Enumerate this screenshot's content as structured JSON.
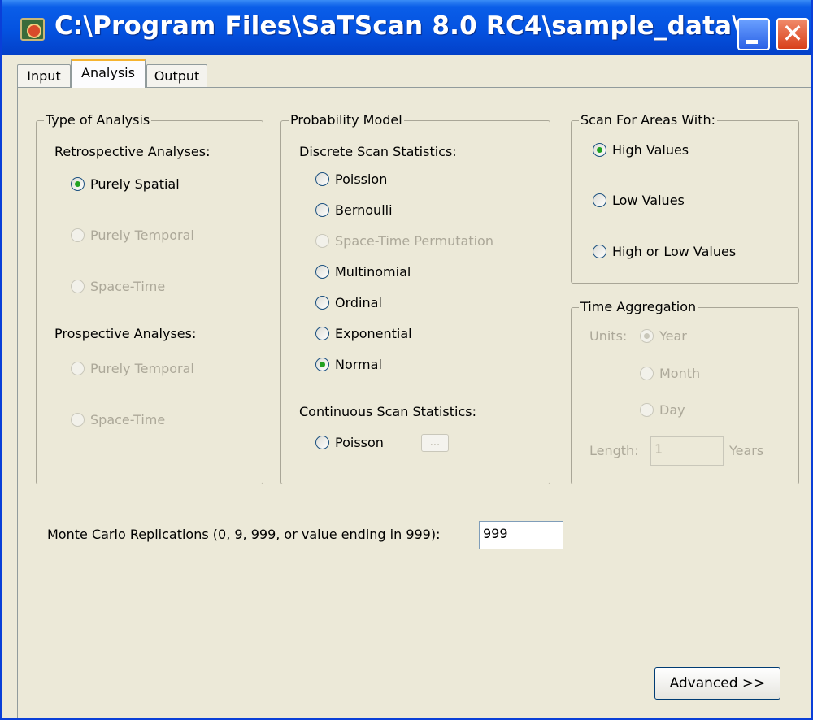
{
  "window": {
    "title": "C:\\Program Files\\SaTScan 8.0 RC4\\sample_data\\..."
  },
  "tabs": [
    {
      "label": "Input"
    },
    {
      "label": "Analysis"
    },
    {
      "label": "Output"
    }
  ],
  "type_of_analysis": {
    "legend": "Type of Analysis",
    "retrospective_label": "Retrospective Analyses:",
    "retrospective": [
      {
        "label": "Purely Spatial",
        "selected": true,
        "enabled": true
      },
      {
        "label": "Purely Temporal",
        "selected": false,
        "enabled": false
      },
      {
        "label": "Space-Time",
        "selected": false,
        "enabled": false
      }
    ],
    "prospective_label": "Prospective Analyses:",
    "prospective": [
      {
        "label": "Purely Temporal",
        "selected": false,
        "enabled": false
      },
      {
        "label": "Space-Time",
        "selected": false,
        "enabled": false
      }
    ]
  },
  "probability_model": {
    "legend": "Probability Model",
    "discrete_label": "Discrete Scan Statistics:",
    "discrete": [
      {
        "label": "Poission",
        "selected": false,
        "enabled": true
      },
      {
        "label": "Bernoulli",
        "selected": false,
        "enabled": true
      },
      {
        "label": "Space-Time Permutation",
        "selected": false,
        "enabled": false
      },
      {
        "label": "Multinomial",
        "selected": false,
        "enabled": true
      },
      {
        "label": "Ordinal",
        "selected": false,
        "enabled": true
      },
      {
        "label": "Exponential",
        "selected": false,
        "enabled": true
      },
      {
        "label": "Normal",
        "selected": true,
        "enabled": true
      }
    ],
    "continuous_label": "Continuous Scan Statistics:",
    "continuous": [
      {
        "label": "Poisson",
        "selected": false,
        "enabled": true
      }
    ],
    "ellipsis_button": "..."
  },
  "scan_for_areas": {
    "legend": "Scan For Areas With:",
    "options": [
      {
        "label": "High Values",
        "selected": true
      },
      {
        "label": "Low Values",
        "selected": false
      },
      {
        "label": "High or Low Values",
        "selected": false
      }
    ]
  },
  "time_aggregation": {
    "legend": "Time Aggregation",
    "units_label": "Units:",
    "units": [
      {
        "label": "Year",
        "selected": true
      },
      {
        "label": "Month",
        "selected": false
      },
      {
        "label": "Day",
        "selected": false
      }
    ],
    "length_label": "Length:",
    "length_value": "1",
    "length_unit": "Years"
  },
  "monte_carlo": {
    "label": "Monte Carlo Replications (0, 9, 999, or value ending in 999):",
    "value": "999"
  },
  "advanced_button": "Advanced >>"
}
